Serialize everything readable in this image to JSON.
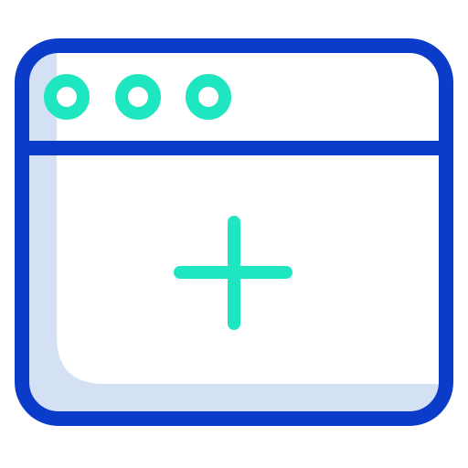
{
  "icon": {
    "name": "new-window-icon",
    "parts": {
      "window": "browser-window",
      "dots": [
        "window-control-dot",
        "window-control-dot",
        "window-control-dot"
      ],
      "plus": "plus-icon"
    }
  },
  "colors": {
    "outline": "#0b3cc9",
    "accent": "#1ee6c0",
    "shadow": "#d4e1f4",
    "fill": "#ffffff"
  }
}
